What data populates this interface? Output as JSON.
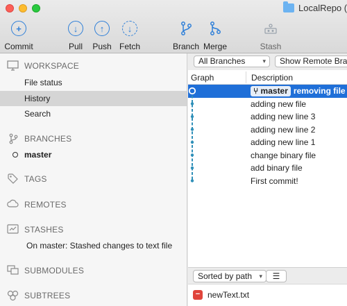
{
  "window": {
    "title": "LocalRepo (G"
  },
  "toolbar": {
    "commit": "Commit",
    "pull": "Pull",
    "push": "Push",
    "fetch": "Fetch",
    "branch": "Branch",
    "merge": "Merge",
    "stash": "Stash"
  },
  "sidebar": {
    "workspace": {
      "header": "WORKSPACE",
      "items": [
        "File status",
        "History",
        "Search"
      ]
    },
    "branches": {
      "header": "BRANCHES",
      "current": "master"
    },
    "tags": {
      "header": "TAGS"
    },
    "remotes": {
      "header": "REMOTES"
    },
    "stashes": {
      "header": "STASHES",
      "items": [
        "On master: Stashed changes to text file"
      ]
    },
    "submodules": {
      "header": "SUBMODULES"
    },
    "subtrees": {
      "header": "SUBTREES"
    }
  },
  "history": {
    "branch_filter": "All Branches",
    "remote_filter": "Show Remote Branches",
    "columns": {
      "graph": "Graph",
      "description": "Description"
    },
    "commits": [
      {
        "branch": "master",
        "description": "removing file"
      },
      {
        "description": "adding new file"
      },
      {
        "description": "adding new line 3"
      },
      {
        "description": "adding new line 2"
      },
      {
        "description": "adding new line 1"
      },
      {
        "description": "change binary file"
      },
      {
        "description": "add binary file"
      },
      {
        "description": "First commit!"
      }
    ]
  },
  "files": {
    "sort_label": "Sorted by path",
    "list_icon": "list-icon",
    "items": [
      {
        "name": "newText.txt",
        "status": "removed"
      }
    ]
  },
  "colors": {
    "accent": "#1f6fd8",
    "graph_line": "#2f8fb8",
    "removed": "#e0443b"
  }
}
